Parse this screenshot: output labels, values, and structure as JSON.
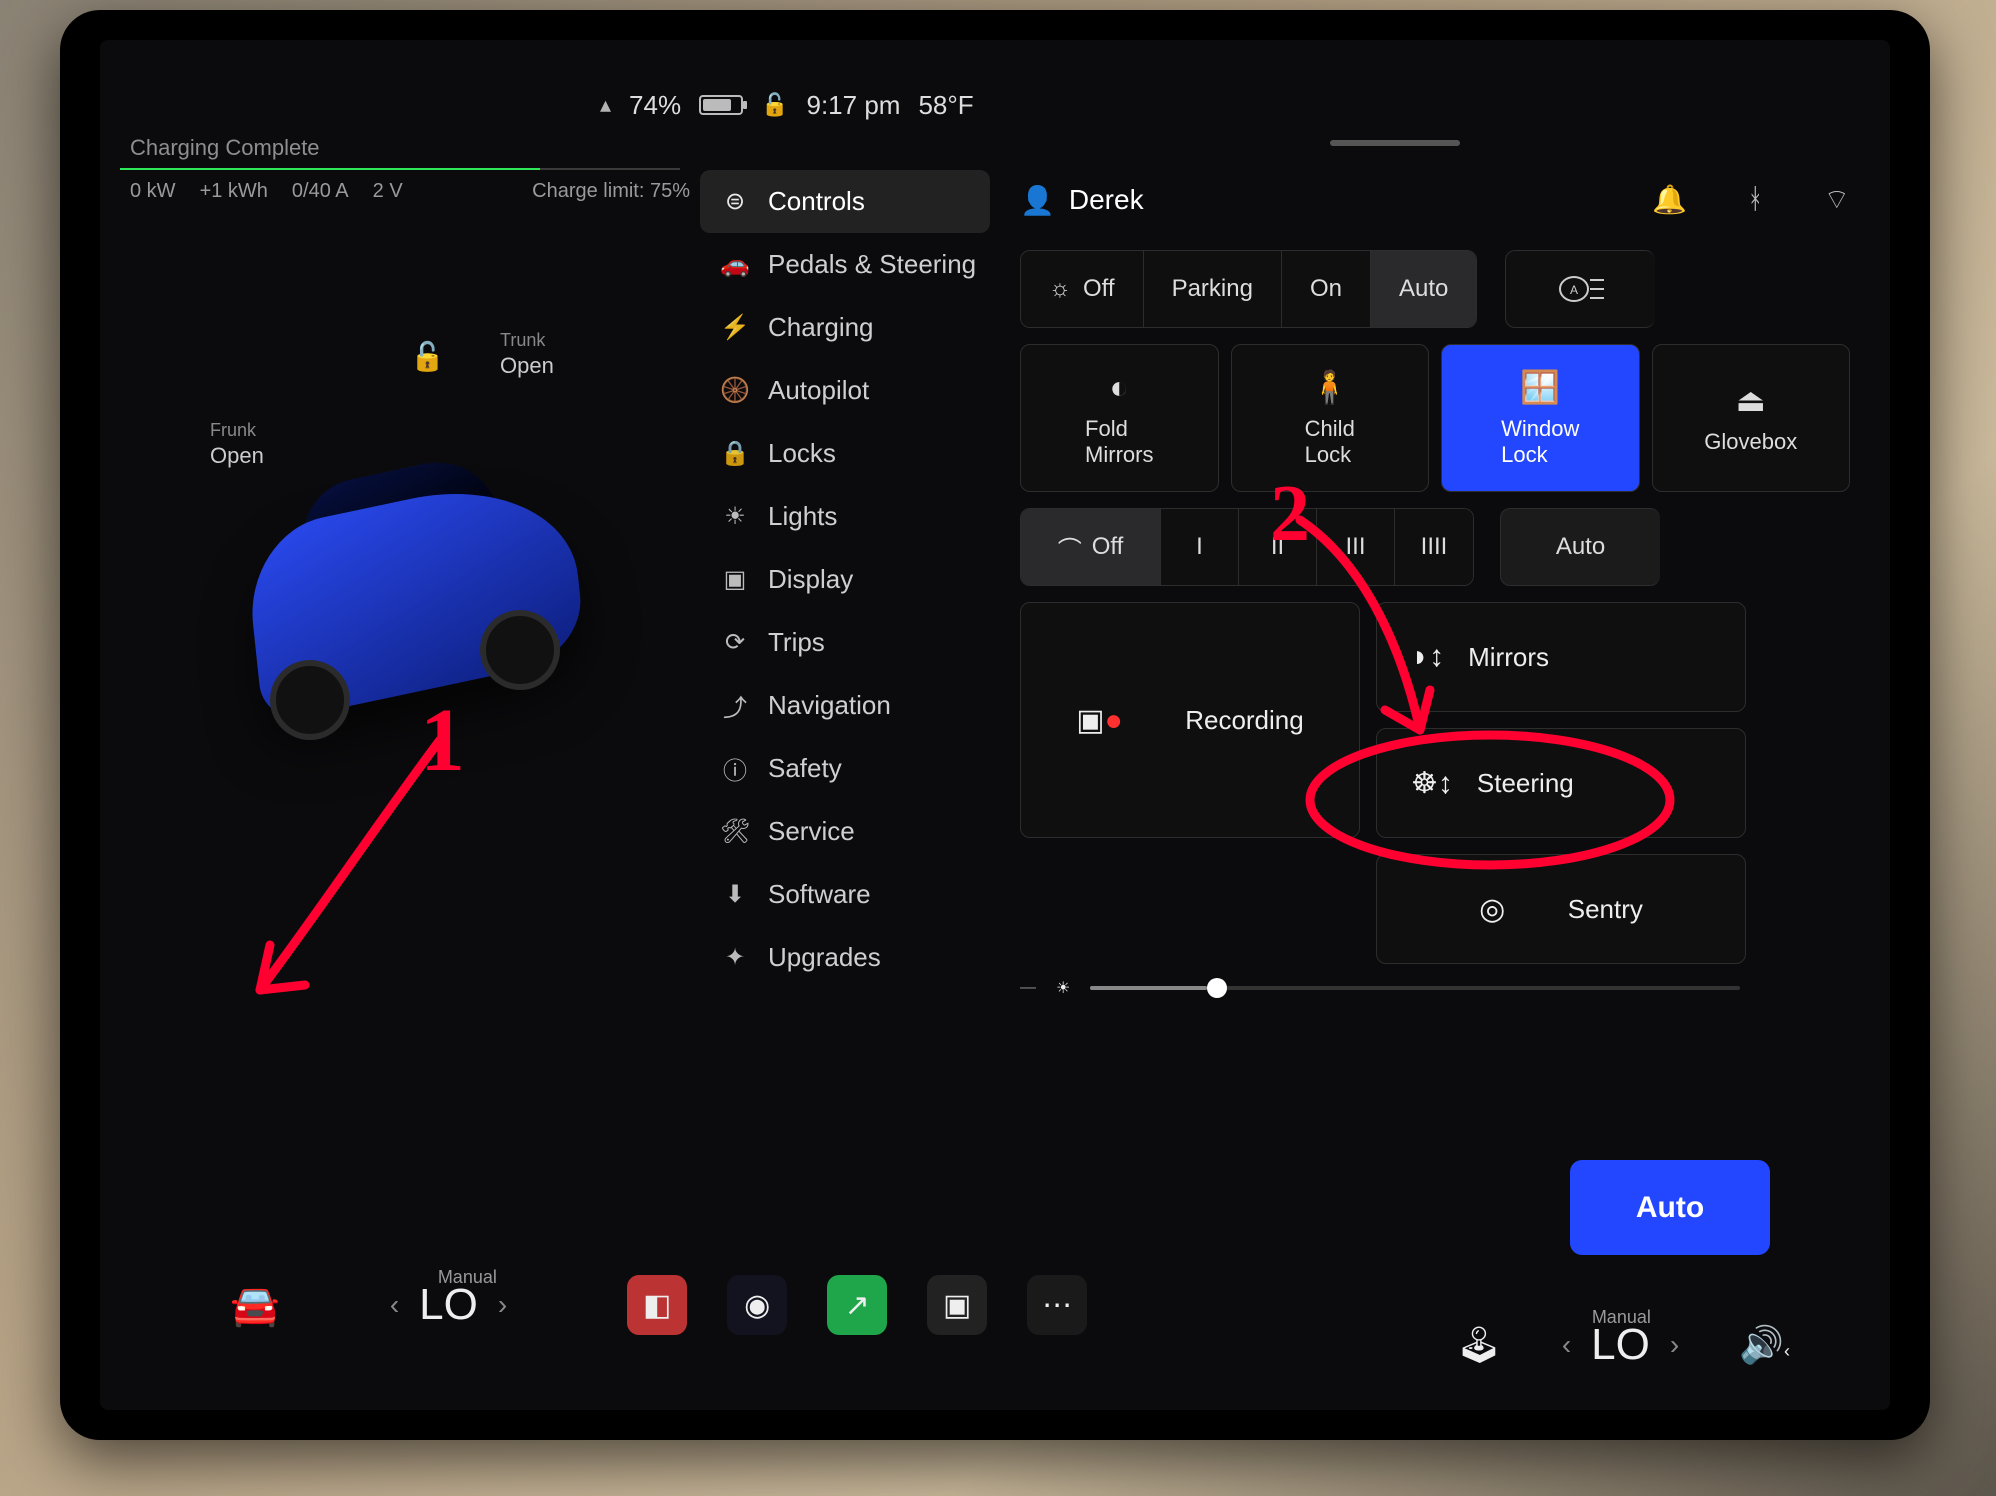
{
  "status": {
    "battery_pct": "74%",
    "time": "9:17 pm",
    "temp": "58°F"
  },
  "charging": {
    "title": "Charging Complete",
    "kw": "0 kW",
    "kwh": "+1 kWh",
    "amps": "0/40 A",
    "volts": "2 V",
    "limit_label": "Charge limit: 75%"
  },
  "car": {
    "frunk_label": "Frunk",
    "frunk_state": "Open",
    "trunk_label": "Trunk",
    "trunk_state": "Open"
  },
  "sidebar": [
    {
      "icon": "⊜",
      "label": "Controls",
      "active": true
    },
    {
      "icon": "🚗",
      "label": "Pedals & Steering"
    },
    {
      "icon": "⚡",
      "label": "Charging"
    },
    {
      "icon": "🛞",
      "label": "Autopilot"
    },
    {
      "icon": "🔒",
      "label": "Locks"
    },
    {
      "icon": "☀",
      "label": "Lights"
    },
    {
      "icon": "▣",
      "label": "Display"
    },
    {
      "icon": "⟳",
      "label": "Trips"
    },
    {
      "icon": "⤴",
      "label": "Navigation"
    },
    {
      "icon": "ⓘ",
      "label": "Safety"
    },
    {
      "icon": "🛠",
      "label": "Service"
    },
    {
      "icon": "⬇",
      "label": "Software"
    },
    {
      "icon": "✦",
      "label": "Upgrades"
    }
  ],
  "user_name": "Derek",
  "lights_segments": [
    "Off",
    "Parking",
    "On",
    "Auto"
  ],
  "lights_selected": 3,
  "tiles_row1": [
    {
      "icon": "◐",
      "label": "Fold Mirrors",
      "sel": false
    },
    {
      "icon": "🧍",
      "label": "Child Lock",
      "sel": false
    },
    {
      "icon": "🪟",
      "label": "Window Lock",
      "sel": true
    },
    {
      "icon": "⏏",
      "label": "Glovebox",
      "sel": false
    }
  ],
  "wiper": {
    "off": "Off",
    "levels": [
      "I",
      "II",
      "III",
      "IIII"
    ],
    "auto": "Auto"
  },
  "adjust": [
    {
      "icon": "◗↕",
      "label": "Mirrors"
    },
    {
      "icon": "◉●",
      "label": "Recording"
    },
    {
      "icon": "☸↕",
      "label": "Steering"
    },
    {
      "icon": "◎",
      "label": "Sentry"
    }
  ],
  "footer_auto": "Auto",
  "dock": {
    "climate_left": {
      "mode": "Manual",
      "value": "LO"
    },
    "climate_right": {
      "mode": "Manual",
      "value": "LO"
    }
  },
  "annotations": {
    "one": "1",
    "two": "2"
  }
}
